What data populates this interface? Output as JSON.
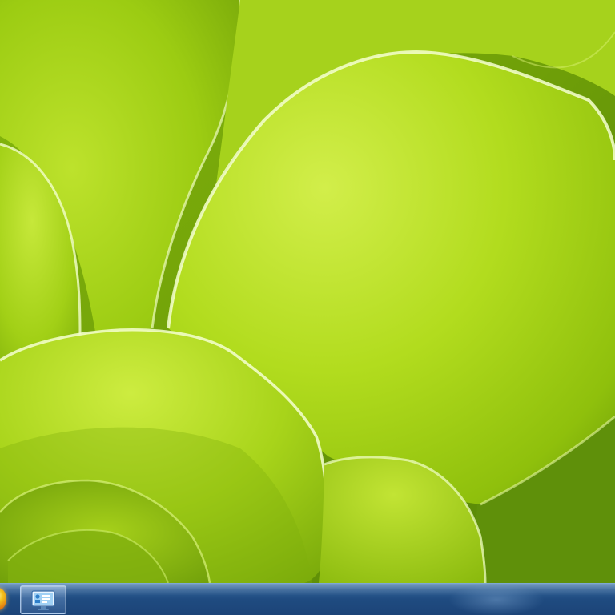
{
  "desktop": {
    "wallpaper": "green-succulent-leaves",
    "colors": {
      "leaf_light": "#c7e63a",
      "leaf_mid": "#9bcc12",
      "leaf_dark": "#5a8a0a",
      "leaf_edge": "#f4ffd0"
    }
  },
  "taskbar": {
    "colors": {
      "top": "#4f7fb0",
      "bottom": "#1c4478",
      "border": "#7ea8d4"
    },
    "start_button": {
      "icon": "windows-orb-icon"
    },
    "pinned_items": [
      {
        "icon": "control-panel-icon",
        "active": true
      }
    ]
  }
}
